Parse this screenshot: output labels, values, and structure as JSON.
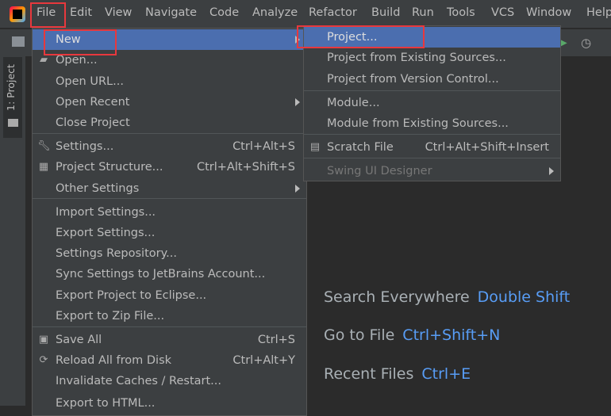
{
  "menubar": {
    "items": [
      "File",
      "Edit",
      "View",
      "Navigate",
      "Code",
      "Analyze",
      "Refactor",
      "Build",
      "Run",
      "Tools",
      "VCS",
      "Window",
      "Help"
    ]
  },
  "sidebar": {
    "tab": "1: Project"
  },
  "file_menu": {
    "items": [
      {
        "label": "New",
        "shortcut": "",
        "submenu": true,
        "selected": true
      },
      {
        "label": "Open...",
        "shortcut": "",
        "icon": "folder-open-icon"
      },
      {
        "label": "Open URL...",
        "shortcut": ""
      },
      {
        "label": "Open Recent",
        "shortcut": "",
        "submenu": true
      },
      {
        "label": "Close Project",
        "shortcut": ""
      },
      {
        "label": "Settings...",
        "shortcut": "Ctrl+Alt+S",
        "icon": "wrench-icon"
      },
      {
        "label": "Project Structure...",
        "shortcut": "Ctrl+Alt+Shift+S",
        "icon": "project-structure-icon"
      },
      {
        "label": "Other Settings",
        "shortcut": "",
        "submenu": true
      },
      {
        "label": "Import Settings...",
        "shortcut": ""
      },
      {
        "label": "Export Settings...",
        "shortcut": ""
      },
      {
        "label": "Settings Repository...",
        "shortcut": ""
      },
      {
        "label": "Sync Settings to JetBrains Account...",
        "shortcut": ""
      },
      {
        "label": "Export Project to Eclipse...",
        "shortcut": ""
      },
      {
        "label": "Export to Zip File...",
        "shortcut": ""
      },
      {
        "label": "Save All",
        "shortcut": "Ctrl+S",
        "icon": "save-icon"
      },
      {
        "label": "Reload All from Disk",
        "shortcut": "Ctrl+Alt+Y",
        "icon": "reload-icon"
      },
      {
        "label": "Invalidate Caches / Restart...",
        "shortcut": ""
      },
      {
        "label": "Export to HTML...",
        "shortcut": ""
      }
    ]
  },
  "new_submenu": {
    "items": [
      {
        "label": "Project...",
        "shortcut": "",
        "selected": true
      },
      {
        "label": "Project from Existing Sources...",
        "shortcut": ""
      },
      {
        "label": "Project from Version Control...",
        "shortcut": ""
      },
      {
        "label": "Module...",
        "shortcut": ""
      },
      {
        "label": "Module from Existing Sources...",
        "shortcut": ""
      },
      {
        "label": "Scratch File",
        "shortcut": "Ctrl+Alt+Shift+Insert",
        "icon": "scratch-file-icon"
      },
      {
        "label": "Swing UI Designer",
        "shortcut": "",
        "submenu": true,
        "disabled": true
      }
    ]
  },
  "hints": [
    {
      "label": "Search Everywhere",
      "key": "Double Shift"
    },
    {
      "label": "Go to File",
      "key": "Ctrl+Shift+N"
    },
    {
      "label": "Recent Files",
      "key": "Ctrl+E"
    }
  ],
  "colors": {
    "selection": "#4b6eaf",
    "highlight_box": "#e8383d",
    "link": "#589df6"
  }
}
